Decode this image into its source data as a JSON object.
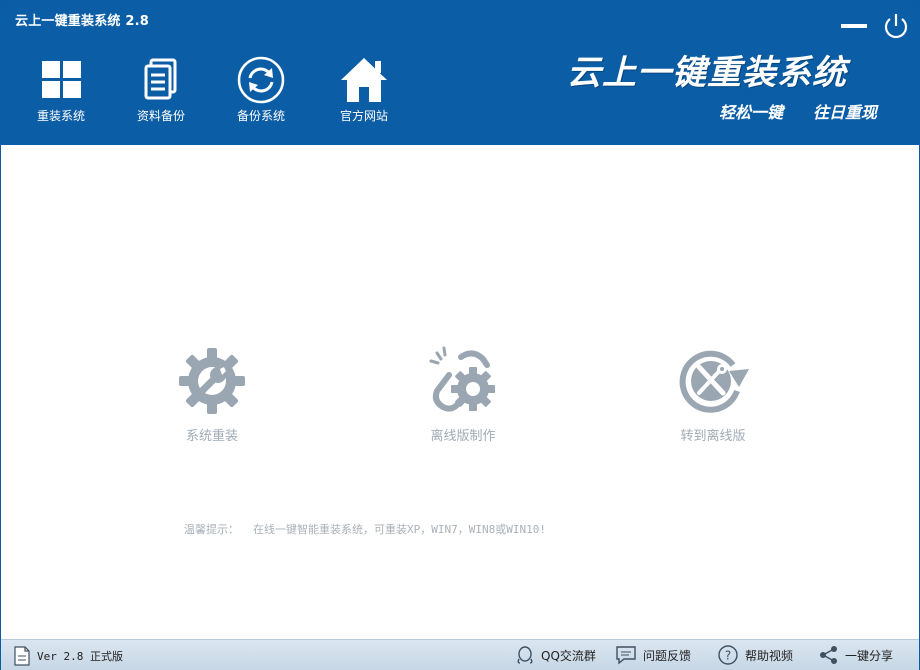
{
  "window": {
    "title": "云上一键重装系统 2.8"
  },
  "nav": [
    {
      "label": "重装系统",
      "icon": "windows-logo-icon"
    },
    {
      "label": "资料备份",
      "icon": "document-stack-icon"
    },
    {
      "label": "备份系统",
      "icon": "refresh-circle-icon"
    },
    {
      "label": "官方网站",
      "icon": "home-icon"
    }
  ],
  "brand": {
    "name": "云上一键重装系统",
    "slogan1": "轻松一键",
    "slogan2": "往日重现"
  },
  "actions": [
    {
      "label": "系统重装",
      "icon": "gear-wrench-icon"
    },
    {
      "label": "离线版制作",
      "icon": "offline-gear-icon"
    },
    {
      "label": "转到离线版",
      "icon": "tools-rotate-icon"
    }
  ],
  "tip": {
    "label": "温馨提示：",
    "text": "在线一键智能重装系统，可重装XP，WIN7，WIN8或WIN10!"
  },
  "footer": {
    "version": "Ver 2.8 正式版",
    "qq_group": "QQ交流群",
    "feedback": "问题反馈",
    "help_video": "帮助视频",
    "share": "一键分享"
  },
  "colors": {
    "header_bg": "#0b5da6",
    "icon_gray": "#9aa6b2",
    "footer_bg": "#d2dfeb"
  }
}
